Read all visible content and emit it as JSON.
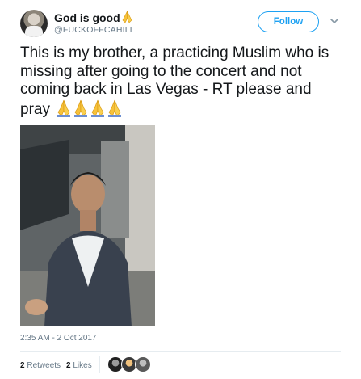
{
  "user": {
    "display_name": "God is good",
    "display_emoji": "folded-hands-emoji",
    "handle": "@FUCKOFFCAHILL"
  },
  "follow_button": {
    "label": "Follow"
  },
  "menu_icon": "chevron-down-icon",
  "tweet": {
    "text": "This is my brother, a practicing Muslim who is missing after going to the concert and not coming back in Las Vegas - RT please and pray",
    "trailing_emoji_count": 4,
    "emoji": "folded-hands-emoji"
  },
  "photo": {
    "icon": "photo"
  },
  "meta": {
    "timestamp": "2:35 AM - 2 Oct 2017"
  },
  "stats": {
    "retweets_count": "2",
    "retweets_label": "Retweets",
    "likes_count": "2",
    "likes_label": "Likes"
  },
  "colors": {
    "accent": "#1da1f2",
    "text_primary": "#14171a",
    "text_secondary": "#657786",
    "divider": "#e6ecf0",
    "emoji_yellow": "#f7c23b"
  }
}
